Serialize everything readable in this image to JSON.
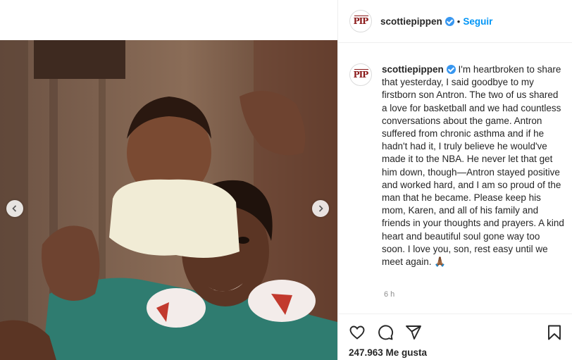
{
  "post": {
    "username": "scottiepippen",
    "follow_label": "Seguir",
    "separator": "•",
    "avatar_text": "PIP",
    "caption": "I'm heartbroken to share that yesterday, I said goodbye to my firstborn son Antron. The two of us shared a love for basketball and we had countless conversations about the game. Antron suffered from chronic asthma and if he hadn't had it, I truly believe he would've made it to the NBA. He never let that get him down, though—Antron stayed positive and worked hard, and I am so proud of the man that he became. Please keep his mom, Karen, and all of his family and friends in your thoughts and prayers. A kind heart and beautiful soul gone way too soon. I love you, son, rest easy until we meet again. 🙏🏾",
    "time_ago": "6 h",
    "likes": "247.963 Me gusta"
  },
  "icons": {
    "like": "heart-icon",
    "comment": "comment-icon",
    "share": "paper-plane-icon",
    "save": "bookmark-icon",
    "prev": "chevron-left-icon",
    "next": "chevron-right-icon"
  },
  "colors": {
    "link": "#0095f6",
    "verified": "#3897f0",
    "avatar_text": "#8b1a1a"
  }
}
